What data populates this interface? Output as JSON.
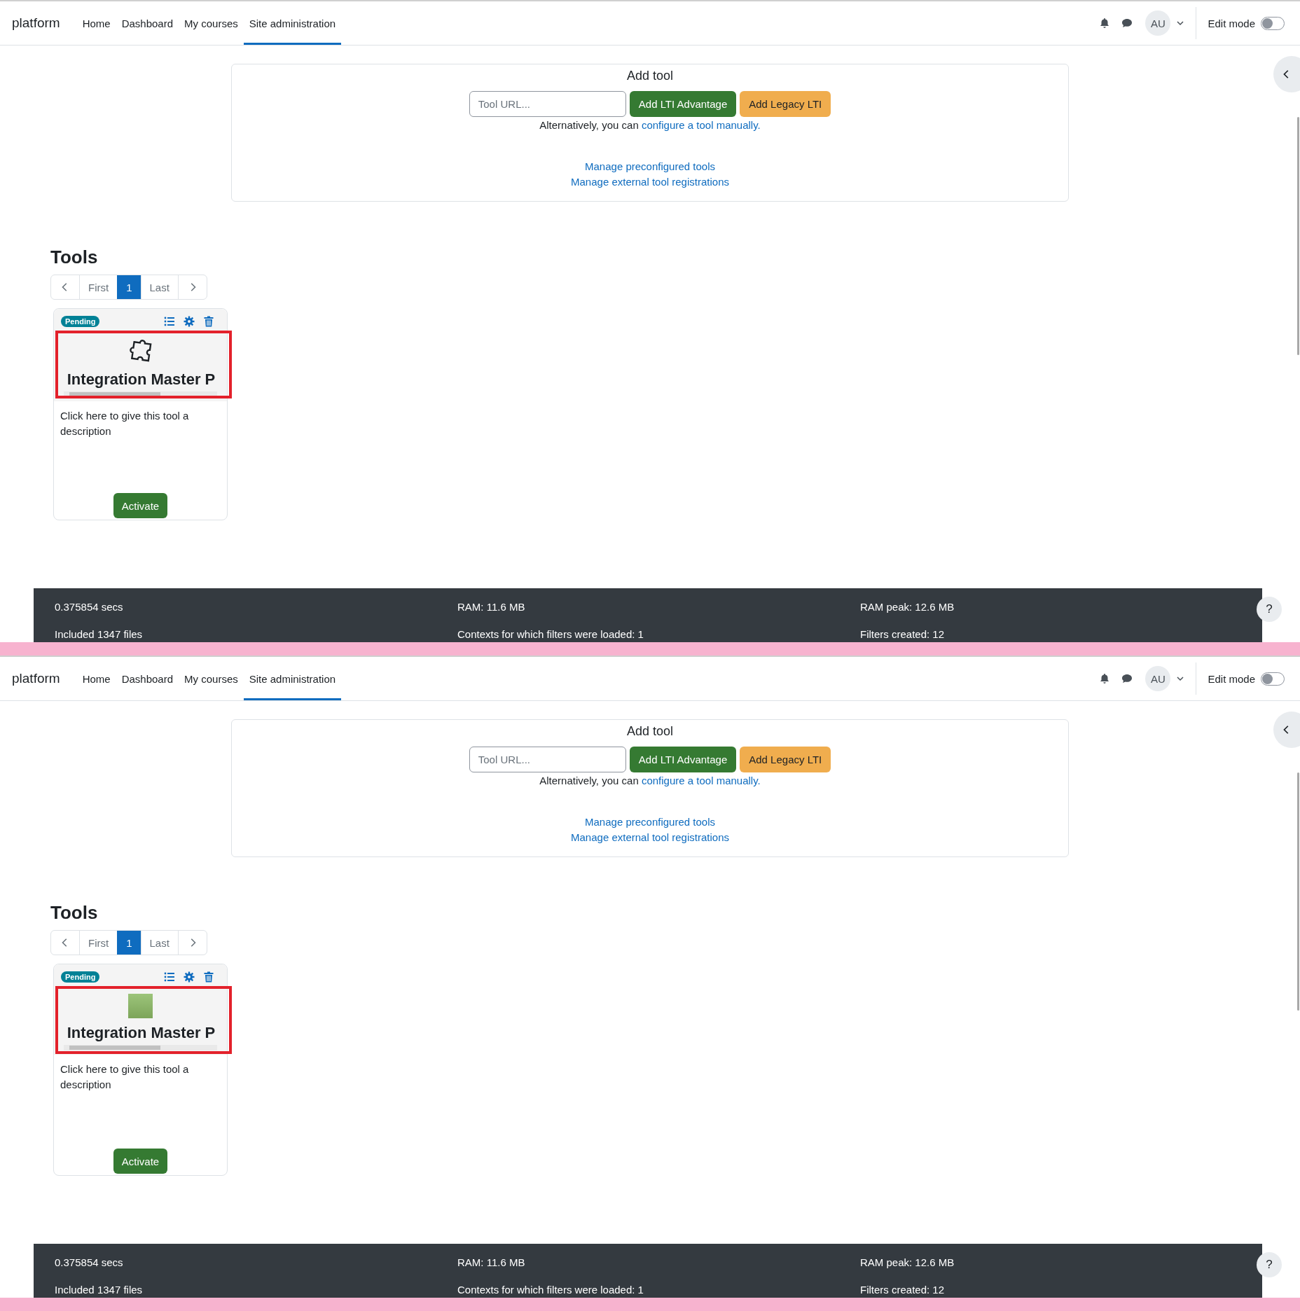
{
  "screens": [
    {
      "navbar": {
        "brand": "platform",
        "links": [
          {
            "label": "Home",
            "selected": false
          },
          {
            "label": "Dashboard",
            "selected": false
          },
          {
            "label": "My courses",
            "selected": false
          },
          {
            "label": "Site administration",
            "selected": true
          }
        ],
        "avatar": "AU",
        "edit_mode": {
          "label": "Edit mode",
          "on": false
        }
      },
      "add_tool": {
        "title": "Add tool",
        "url_field": {
          "placeholder": "Tool URL..."
        },
        "buttons": [
          {
            "label": "Add LTI Advantage",
            "kind": "primary"
          },
          {
            "label": "Add Legacy LTI",
            "kind": "warning"
          }
        ],
        "alternative": {
          "text": "Alternatively, you can ",
          "link": "configure a tool manually."
        },
        "links": [
          "Manage preconfigured tools",
          "Manage external tool registrations"
        ]
      },
      "tools": {
        "heading": "Tools",
        "pagination": [
          {
            "kind": "prev",
            "selected": false
          },
          {
            "kind": "page",
            "label": "First",
            "selected": false
          },
          {
            "kind": "page",
            "label": "1",
            "selected": true
          },
          {
            "kind": "page",
            "label": "Last",
            "selected": false
          },
          {
            "kind": "next",
            "selected": false
          }
        ],
        "cards": [
          {
            "status": "Pending",
            "kind": "icon",
            "name": "Integration Master P",
            "description": "Click here to give this tool a description",
            "action": "Activate"
          }
        ]
      },
      "footer": [
        "0.375854 secs",
        "RAM: 11.6 MB",
        "RAM peak: 12.6 MB",
        "Included 1347 files",
        "Contexts for which filters were loaded: 1",
        "Filters created: 12"
      ],
      "help": "?"
    },
    {
      "navbar": {
        "brand": "platform",
        "links": [
          {
            "label": "Home",
            "selected": false
          },
          {
            "label": "Dashboard",
            "selected": false
          },
          {
            "label": "My courses",
            "selected": false
          },
          {
            "label": "Site administration",
            "selected": true
          }
        ],
        "avatar": "AU",
        "edit_mode": {
          "label": "Edit mode",
          "on": false
        }
      },
      "add_tool": {
        "title": "Add tool",
        "url_field": {
          "placeholder": "Tool URL..."
        },
        "buttons": [
          {
            "label": "Add LTI Advantage",
            "kind": "primary"
          },
          {
            "label": "Add Legacy LTI",
            "kind": "warning"
          }
        ],
        "alternative": {
          "text": "Alternatively, you can ",
          "link": "configure a tool manually."
        },
        "links": [
          "Manage preconfigured tools",
          "Manage external tool registrations"
        ]
      },
      "tools": {
        "heading": "Tools",
        "pagination": [
          {
            "kind": "prev",
            "selected": false
          },
          {
            "kind": "page",
            "label": "First",
            "selected": false
          },
          {
            "kind": "page",
            "label": "1",
            "selected": true
          },
          {
            "kind": "page",
            "label": "Last",
            "selected": false
          },
          {
            "kind": "next",
            "selected": false
          }
        ],
        "cards": [
          {
            "status": "Pending",
            "kind": "photo",
            "name": "Integration Master P",
            "description": "Click here to give this tool a description",
            "action": "Activate"
          }
        ]
      },
      "footer": [
        "0.375854 secs",
        "RAM: 11.6 MB",
        "RAM peak: 12.6 MB",
        "Included 1347 files",
        "Contexts for which filters were loaded: 1",
        "Filters created: 12"
      ],
      "help": "?"
    }
  ]
}
